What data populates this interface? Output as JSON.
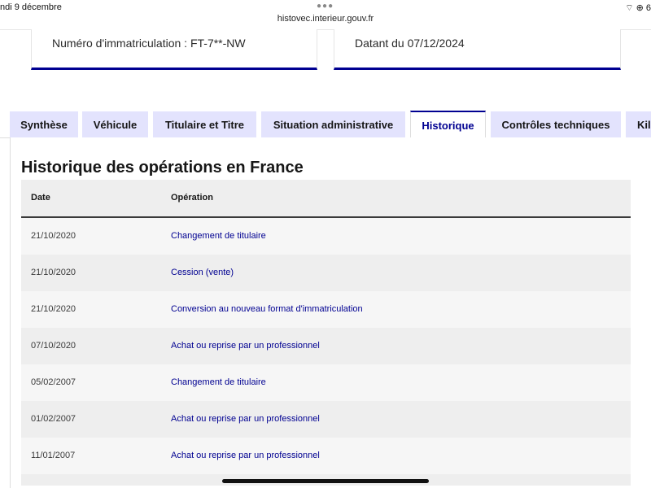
{
  "status_bar": {
    "time_date": "ndi 9 décembre",
    "url": "histovec.interieur.gouv.fr",
    "icons": "⌔ ⊕ 6"
  },
  "cards": {
    "registration": "Numéro d'immatriculation : FT-7**-NW",
    "dated": "Datant du 07/12/2024"
  },
  "tabs": [
    {
      "label": "Synthèse"
    },
    {
      "label": "Véhicule"
    },
    {
      "label": "Titulaire et Titre"
    },
    {
      "label": "Situation administrative"
    },
    {
      "label": "Historique"
    },
    {
      "label": "Contrôles techniques"
    },
    {
      "label": "Kilo"
    }
  ],
  "active_tab": "Historique",
  "section": {
    "title": "Historique des opérations en France"
  },
  "table": {
    "headers": {
      "date": "Date",
      "operation": "Opération"
    },
    "rows": [
      {
        "date": "21/10/2020",
        "operation": "Changement de titulaire"
      },
      {
        "date": "21/10/2020",
        "operation": "Cession (vente)"
      },
      {
        "date": "21/10/2020",
        "operation": "Conversion au nouveau format d'immatriculation"
      },
      {
        "date": "07/10/2020",
        "operation": "Achat ou reprise par un professionnel"
      },
      {
        "date": "05/02/2007",
        "operation": "Changement de titulaire"
      },
      {
        "date": "01/02/2007",
        "operation": "Achat ou reprise par un professionnel"
      },
      {
        "date": "11/01/2007",
        "operation": "Achat ou reprise par un professionnel"
      }
    ]
  },
  "colors": {
    "accent": "#000091",
    "tab_bg": "#e3e3fd",
    "header_bg": "#eeeeee"
  }
}
